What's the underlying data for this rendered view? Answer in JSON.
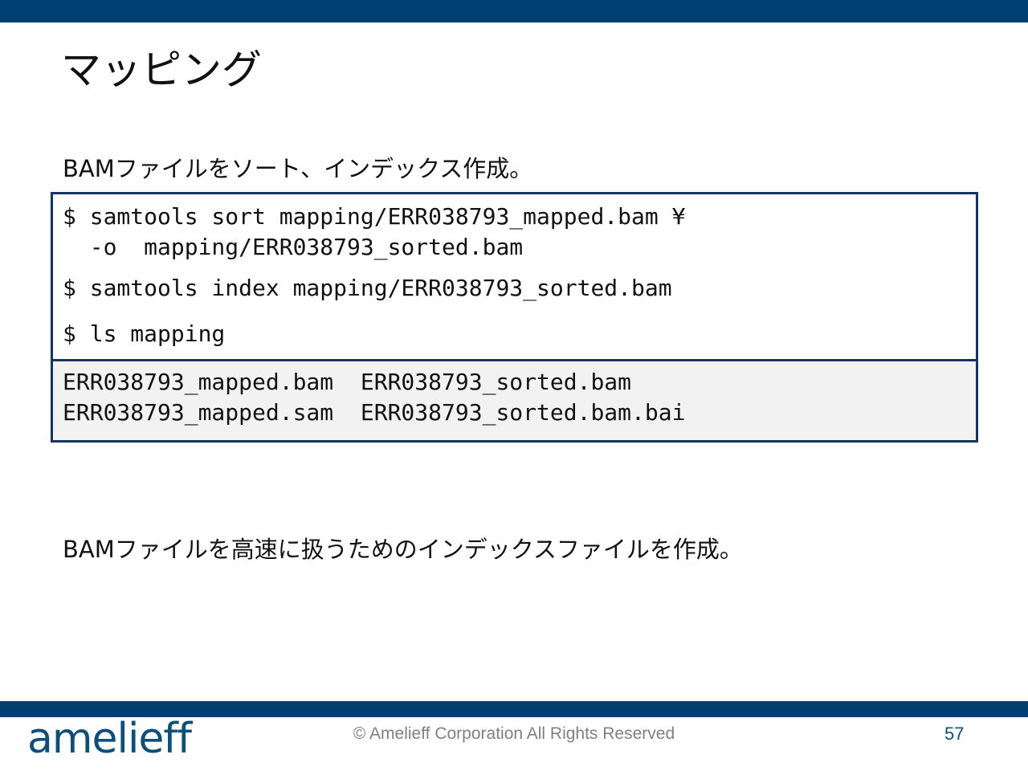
{
  "slide": {
    "title": "マッピング",
    "subtitle": "BAMファイルをソート、インデックス作成。",
    "commands": {
      "line1": "$ samtools sort mapping/ERR038793_mapped.bam ¥",
      "line1b": "  -o  mapping/ERR038793_sorted.bam",
      "line2": "$ samtools index mapping/ERR038793_sorted.bam",
      "line3": "$ ls mapping"
    },
    "output": {
      "line1": "ERR038793_mapped.bam  ERR038793_sorted.bam",
      "line2": "ERR038793_mapped.sam  ERR038793_sorted.bam.bai"
    },
    "note": "BAMファイルを高速に扱うためのインデックスファイルを作成。"
  },
  "footer": {
    "logo": "amelieff",
    "copyright": "© Amelieff Corporation All Rights Reserved",
    "page_number": "57"
  },
  "colors": {
    "bar": "#003f72",
    "box_border": "#16345d",
    "output_bg": "#f2f2f2",
    "logo": "#0e4f7a"
  }
}
